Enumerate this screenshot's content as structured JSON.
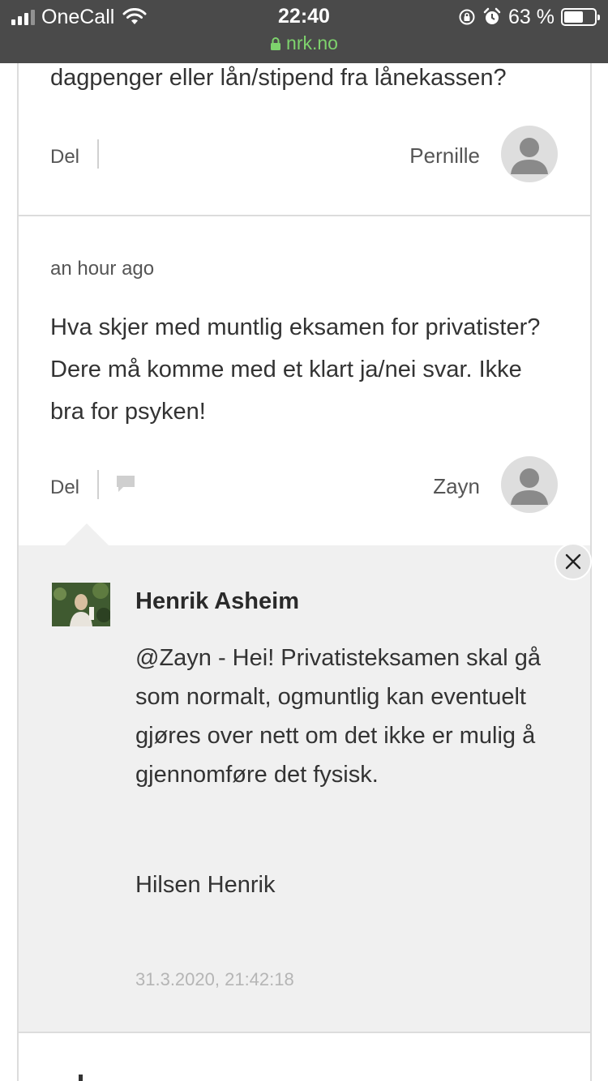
{
  "status_bar": {
    "carrier": "OneCall",
    "time": "22:40",
    "url": "nrk.no",
    "battery_text": "63 %",
    "battery_level": 0.63,
    "icons": [
      "signal-icon",
      "wifi-icon",
      "lock-icon",
      "rotation-lock-icon",
      "alarm-icon",
      "battery-icon"
    ]
  },
  "comment1": {
    "text_fragment": "dagpenger eller lån/stipend fra lånekassen?",
    "share_label": "Del",
    "author": "Pernille"
  },
  "comment2": {
    "timestamp": "an hour ago",
    "text": "Hva skjer med muntlig eksamen for privatister? Dere må komme med et klart ja/nei svar. Ikke bra for psyken!",
    "share_label": "Del",
    "author": "Zayn"
  },
  "reply": {
    "author": "Henrik Asheim",
    "text": "@Zayn - Hei! Privatisteksamen skal gå som normalt, ogmuntlig kan eventuelt gjøres over nett om det ikke er mulig å gjennomføre det fysisk.",
    "signature": "Hilsen Henrik",
    "date": "31.3.2020, 21:42:18"
  },
  "colors": {
    "status_bg": "#4a4a4a",
    "url_green": "#7ed36d",
    "reply_bg": "#f0f0f0",
    "border": "#dcdcdc"
  }
}
